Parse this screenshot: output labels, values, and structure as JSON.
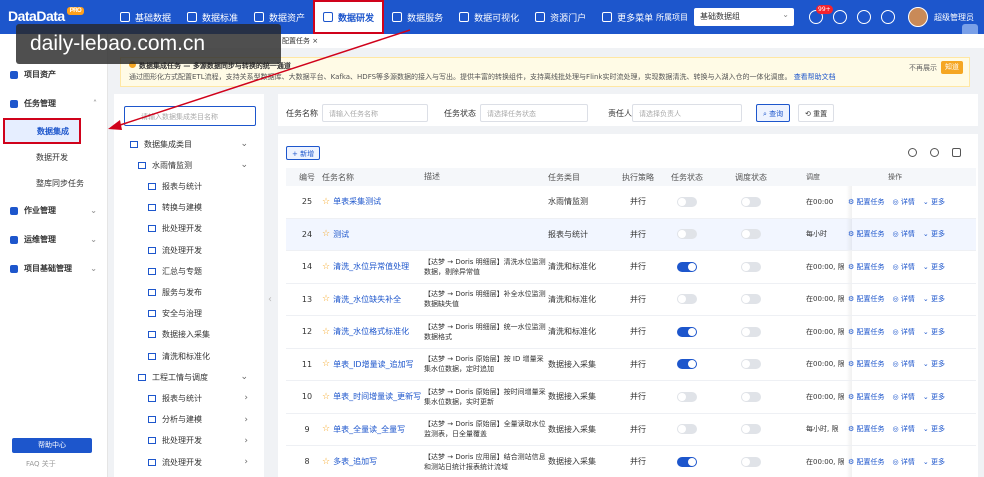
{
  "app": {
    "logo": "DataData",
    "version": "PRO"
  },
  "topnav": [
    {
      "label": "基础数据",
      "active": false
    },
    {
      "label": "数据标准",
      "active": false
    },
    {
      "label": "数据资产",
      "active": false
    },
    {
      "label": "数据研发",
      "active": true
    },
    {
      "label": "数据服务",
      "active": false
    },
    {
      "label": "数据可视化",
      "active": false
    },
    {
      "label": "资源门户",
      "active": false
    },
    {
      "label": "更多菜单",
      "active": false
    }
  ],
  "topright": {
    "project_label": "所属项目",
    "project_value": "基础数据组",
    "notif_badge": "99+",
    "user": "超级管理员"
  },
  "watermark": "daily-lebao.com.cn",
  "sidebar": {
    "menus": [
      {
        "label": "项目资产"
      },
      {
        "label": "任务管理"
      },
      {
        "label": "作业管理"
      },
      {
        "label": "运维管理"
      },
      {
        "label": "项目基础管理"
      }
    ],
    "subs": [
      {
        "label": "数据集成",
        "active": true
      },
      {
        "label": "数据开发",
        "active": false
      },
      {
        "label": "整库同步任务",
        "active": false
      }
    ],
    "help": "帮助中心",
    "footer": "FAQ  关于"
  },
  "tabbar": {
    "tab": "配置任务 ×"
  },
  "notice": {
    "title": "数据集成任务 — 多源数据同步与转换的统一通道",
    "body": "通过图形化方式配置ETL流程，支持关系型数据库、大数据平台、Kafka、HDFS等多源数据的接入与写出。提供丰富的转换组件，支持离线批处理与Flink实时流处理，实现数据清洗、转换与入湖入仓的一体化调度。",
    "link": "查看帮助文档",
    "nomore": "不再展示",
    "know": "知道"
  },
  "tree": {
    "search_placeholder": "请输入数据集成类目名称",
    "items": [
      {
        "label": "数据集成类目",
        "level": 0,
        "chev": "⌄"
      },
      {
        "label": "水雨情监测",
        "level": 1,
        "chev": "⌄"
      },
      {
        "label": "报表与统计",
        "level": 2,
        "chev": ""
      },
      {
        "label": "转换与建模",
        "level": 2,
        "chev": ""
      },
      {
        "label": "批处理开发",
        "level": 2,
        "chev": ""
      },
      {
        "label": "流处理开发",
        "level": 2,
        "chev": ""
      },
      {
        "label": "汇总与专题",
        "level": 2,
        "chev": ""
      },
      {
        "label": "服务与发布",
        "level": 2,
        "chev": ""
      },
      {
        "label": "安全与治理",
        "level": 2,
        "chev": ""
      },
      {
        "label": "数据接入采集",
        "level": 2,
        "chev": ""
      },
      {
        "label": "清洗和标准化",
        "level": 2,
        "chev": ""
      },
      {
        "label": "工程工情与调度",
        "level": 1,
        "chev": "⌄"
      },
      {
        "label": "报表与统计",
        "level": 2,
        "chev": "›"
      },
      {
        "label": "分析与建模",
        "level": 2,
        "chev": "›"
      },
      {
        "label": "批处理开发",
        "level": 2,
        "chev": "›"
      },
      {
        "label": "流处理开发",
        "level": 2,
        "chev": "›"
      },
      {
        "label": "汇总与专题",
        "level": 2,
        "chev": "›"
      }
    ]
  },
  "filters": {
    "name_label": "任务名称",
    "name_placeholder": "请输入任务名称",
    "status_label": "任务状态",
    "status_placeholder": "请选择任务状态",
    "owner_label": "责任人",
    "owner_placeholder": "请选择负责人",
    "search_btn": "查询",
    "reset_btn": "重置"
  },
  "toolbar": {
    "new_btn": "+ 新增"
  },
  "table": {
    "headers": [
      "编号",
      "任务名称",
      "描述",
      "任务类目",
      "执行策略",
      "任务状态",
      "调度状态",
      "调度",
      "操作"
    ],
    "ops": {
      "config": "配置任务",
      "detail": "详情",
      "more": "更多"
    },
    "rows": [
      {
        "id": "25",
        "name": "单表采集测试",
        "desc": "",
        "cat": "水雨情监测",
        "policy": "并行",
        "status": false,
        "sched": false,
        "sched_info": "在00:00",
        "highlight": false
      },
      {
        "id": "24",
        "name": "测试",
        "desc": "",
        "cat": "报表与统计",
        "policy": "并行",
        "status": false,
        "sched": false,
        "sched_info": "每小时",
        "highlight": true
      },
      {
        "id": "14",
        "name": "清洗_水位异常值处理",
        "desc": "【达梦 → Doris 明细层】清洗水位监测数据，剔除异常值",
        "cat": "清洗和标准化",
        "policy": "并行",
        "status": true,
        "sched": false,
        "sched_info": "在00:00, 限",
        "highlight": false
      },
      {
        "id": "13",
        "name": "清洗_水位缺失补全",
        "desc": "【达梦 → Doris 明细层】补全水位监测数据缺失值",
        "cat": "清洗和标准化",
        "policy": "并行",
        "status": false,
        "sched": false,
        "sched_info": "在00:00, 限",
        "highlight": false
      },
      {
        "id": "12",
        "name": "清洗_水位格式标准化",
        "desc": "【达梦 → Doris 明细层】统一水位监测数据格式",
        "cat": "清洗和标准化",
        "policy": "并行",
        "status": true,
        "sched": false,
        "sched_info": "在00:00, 限",
        "highlight": false
      },
      {
        "id": "11",
        "name": "单表_ID增量读_追加写",
        "desc": "【达梦 → Doris 原始层】按 ID 增量采集水位数据，定时追加",
        "cat": "数据接入采集",
        "policy": "并行",
        "status": true,
        "sched": false,
        "sched_info": "在00:00, 限",
        "highlight": false
      },
      {
        "id": "10",
        "name": "单表_时间增量读_更新写",
        "desc": "【达梦 → Doris 原始层】按时间增量采集水位数据，实时更新",
        "cat": "数据接入采集",
        "policy": "并行",
        "status": false,
        "sched": false,
        "sched_info": "在00:00, 限",
        "highlight": false
      },
      {
        "id": "9",
        "name": "单表_全量读_全量写",
        "desc": "【达梦 → Doris 原始层】全量读取水位监测表，日全量覆盖",
        "cat": "数据接入采集",
        "policy": "并行",
        "status": false,
        "sched": false,
        "sched_info": "每小时, 限",
        "highlight": false
      },
      {
        "id": "8",
        "name": "多表_追加写",
        "desc": "【达梦 → Doris 应用层】结合测站信息和测站日统计报表统计流域",
        "cat": "数据接入采集",
        "policy": "并行",
        "status": true,
        "sched": false,
        "sched_info": "在00:00, 限",
        "highlight": false
      }
    ]
  }
}
